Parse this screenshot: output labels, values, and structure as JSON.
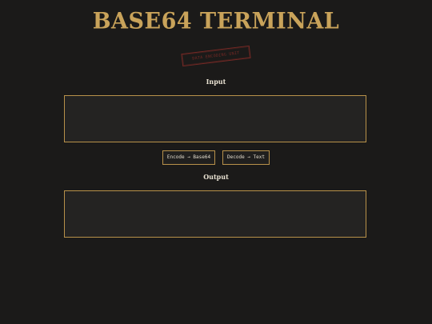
{
  "header": {
    "title": "BASE64 TERMINAL",
    "stamp": "DATA ENCODING UNIT"
  },
  "input": {
    "label": "Input",
    "value": "",
    "placeholder": ""
  },
  "actions": {
    "encode_label": "Encode → Base64",
    "decode_label": "Decode → Text"
  },
  "output": {
    "label": "Output",
    "value": ""
  },
  "colors": {
    "background": "#1b1a19",
    "accent_gold": "#c9a35a",
    "border_gold": "#b8914a",
    "stamp_red": "#7a2a26",
    "panel_bg": "#242322",
    "text_light": "#e9e2d2"
  }
}
